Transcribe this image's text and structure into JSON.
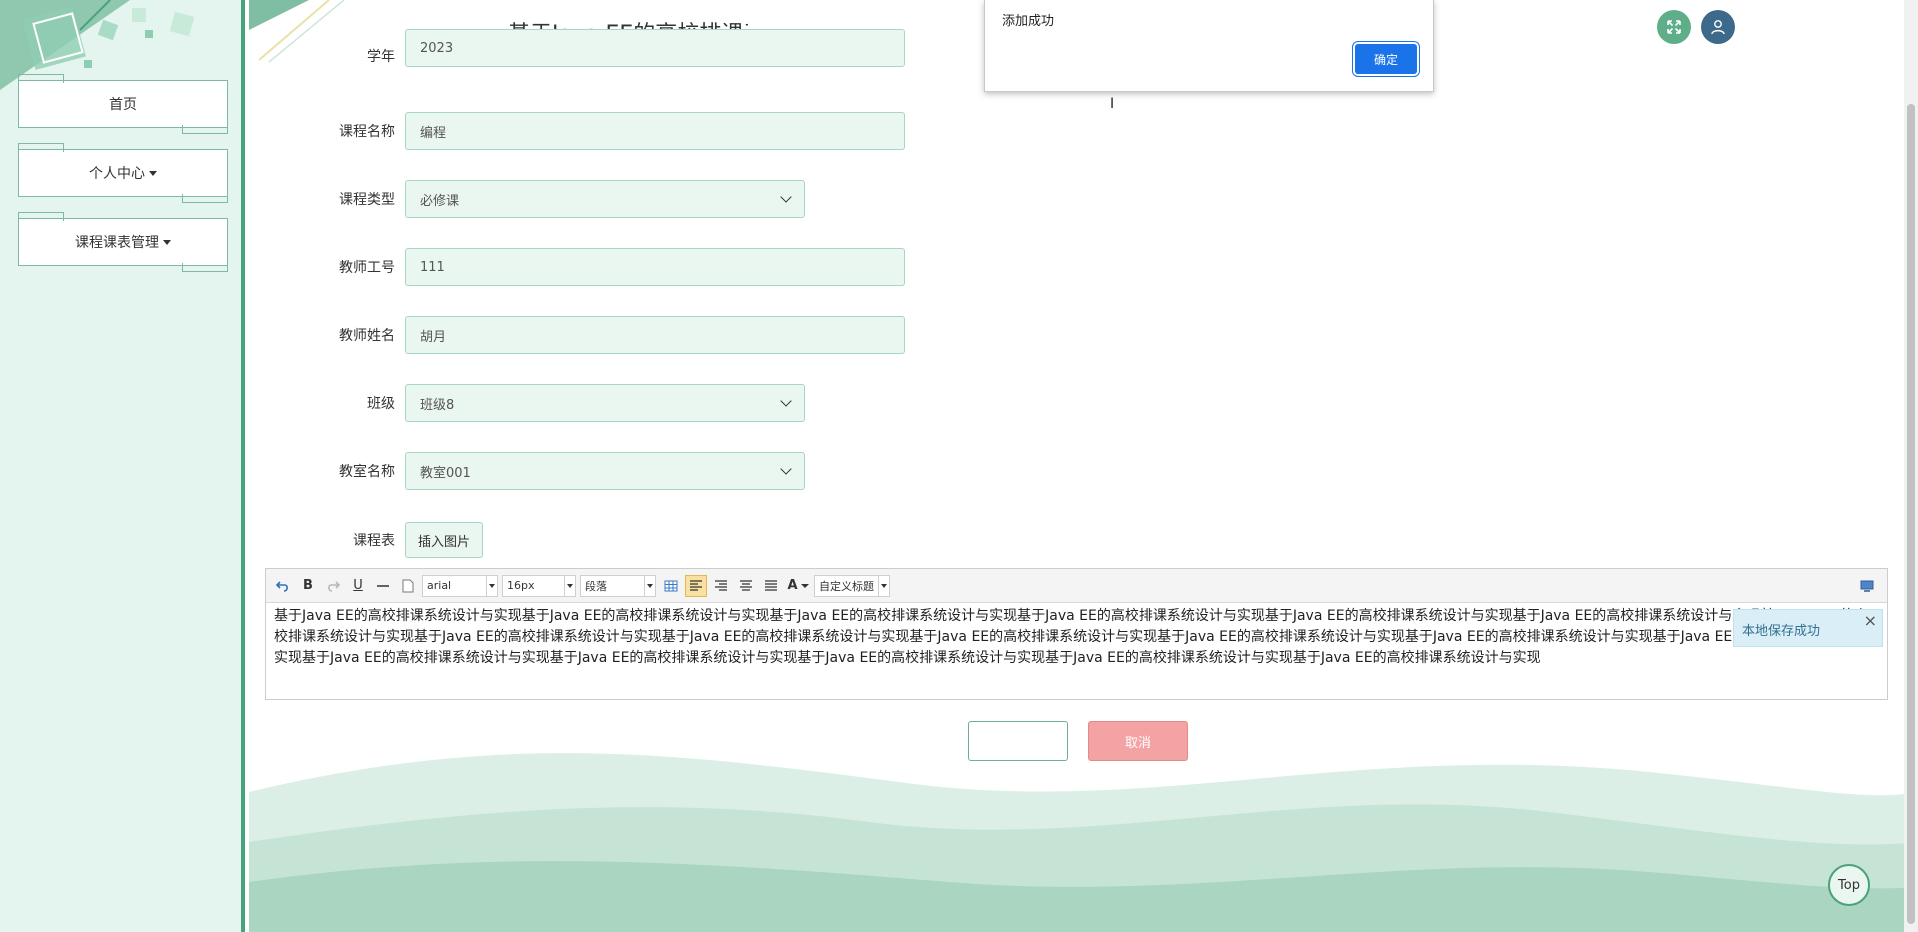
{
  "header": {
    "title": "基于Java EE的高校排课系统设计与实现"
  },
  "sidebar": {
    "items": [
      {
        "label": "首页",
        "has_dropdown": false
      },
      {
        "label": "个人中心",
        "has_dropdown": true
      },
      {
        "label": "课程课表管理",
        "has_dropdown": true
      }
    ]
  },
  "form": {
    "year": {
      "label": "学年",
      "value": "2023"
    },
    "course_name": {
      "label": "课程名称",
      "value": "编程"
    },
    "course_type": {
      "label": "课程类型",
      "value": "必修课"
    },
    "teacher_id": {
      "label": "教师工号",
      "value": "111"
    },
    "teacher_name": {
      "label": "教师姓名",
      "value": "胡月"
    },
    "class": {
      "label": "班级",
      "value": "班级8"
    },
    "classroom": {
      "label": "教室名称",
      "value": "教室001"
    },
    "schedule": {
      "label": "课程表",
      "insert_image_label": "插入图片"
    }
  },
  "editor": {
    "font_family": "arial",
    "font_size": "16px",
    "paragraph": "段落",
    "custom_heading": "自定义标题",
    "content": "基于Java EE的高校排课系统设计与实现基于Java EE的高校排课系统设计与实现基于Java EE的高校排课系统设计与实现基于Java EE的高校排课系统设计与实现基于Java EE的高校排课系统设计与实现基于Java EE的高校排课系统设计与实现基于Java EE的高校排课系统设计与实现基于Java EE的高校排课系统设计与实现基于Java EE的高校排课系统设计与实现基于Java EE的高校排课系统设计与实现基于Java EE的高校排课系统设计与实现基于Java EE的高校排课系统设计与实现基于Java EE的高校排课系统设计与实现基于Java EE的高校排课系统设计与实现基于Java EE的高校排课系统设计与实现基于Java EE的高校排课系统设计与实现基于Java EE的高校排课系统设计与实现基于Java EE的高校排课系统设计与实现",
    "save_tip": "本地保存成功"
  },
  "buttons": {
    "submit_label": "",
    "cancel_label": "取消",
    "top_label": "Top"
  },
  "alert": {
    "message": "添加成功",
    "ok_label": "确定"
  },
  "colors": {
    "accent": "#4aa27c",
    "sidebar_bg": "#e4f4ee",
    "cancel": "#f3a3a3",
    "ok": "#1a73e8"
  },
  "icons": {
    "fullscreen": "fullscreen-icon",
    "user": "user-icon",
    "editor_undo": "undo-icon"
  }
}
